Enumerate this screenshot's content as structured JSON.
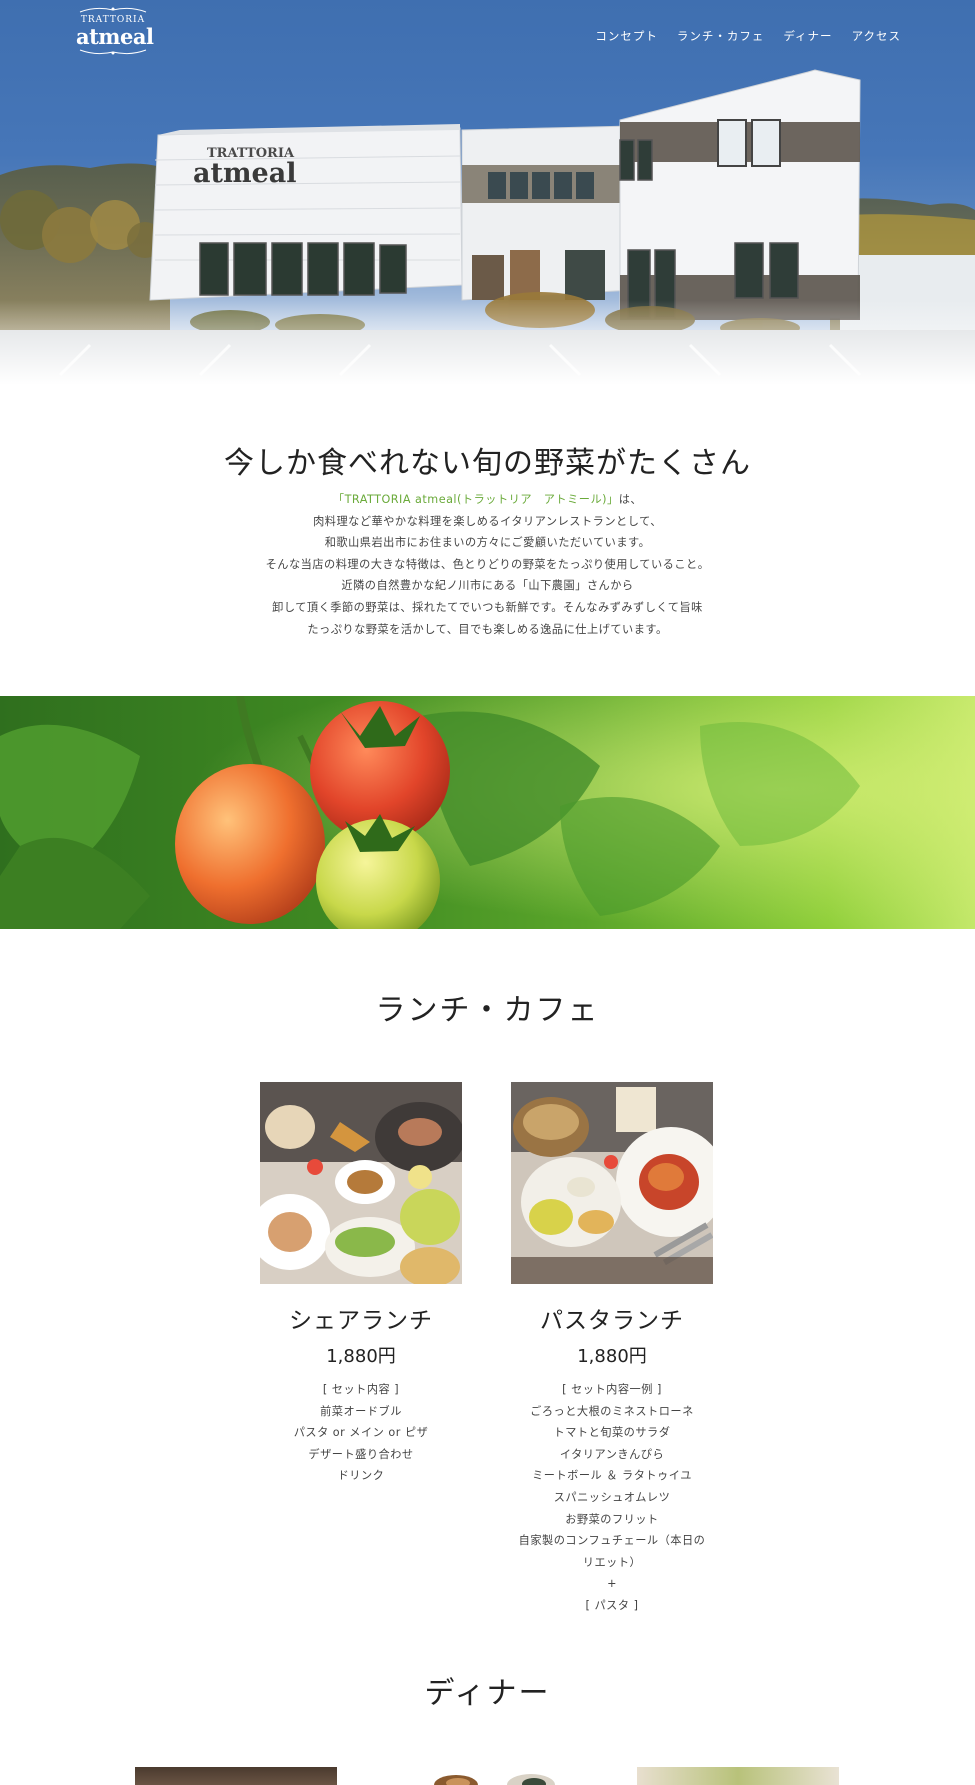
{
  "header": {
    "logo_small": "TRATTORIA",
    "logo_big": "atmeal",
    "nav": [
      "コンセプト",
      "ランチ・カフェ",
      "ディナー",
      "アクセス"
    ]
  },
  "hero": {
    "sign_small": "TRATTORIA",
    "sign_big": "atmeal"
  },
  "concept": {
    "title": "今しか食べれない旬の野菜がたくさん",
    "lead_highlight": "「TRATTORIA atmeal(トラットリア　アトミール)」",
    "lead_rest": "は、",
    "lines": [
      "肉料理など華やかな料理を楽しめるイタリアンレストランとして、",
      "和歌山県岩出市にお住まいの方々にご愛顧いただいています。",
      "そんな当店の料理の大きな特徴は、色とりどりの野菜をたっぷり使用していること。",
      "近隣の自然豊かな紀ノ川市にある「山下農園」さんから",
      "卸して頂く季節の野菜は、採れたてでいつも新鮮です。そんなみずみずしくて旨味",
      "たっぷりな野菜を活かして、目でも楽しめる逸品に仕上げています。"
    ]
  },
  "lunch": {
    "title": "ランチ・カフェ",
    "menus": [
      {
        "name": "シェアランチ",
        "price": "1,880円",
        "lines": [
          "[ セット内容 ]",
          "前菜オードブル",
          "パスタ or メイン or ピザ",
          "デザート盛り合わせ",
          "ドリンク"
        ]
      },
      {
        "name": "パスタランチ",
        "price": "1,880円",
        "lines": [
          "[ セット内容一例 ]",
          "ごろっと大根のミネストローネ",
          "トマトと旬菜のサラダ",
          "イタリアンきんぴら",
          "ミートボール ＆ ラタトゥイユ",
          "スパニッシュオムレツ",
          "お野菜のフリット",
          "自家製のコンフュチェール（本日の",
          "リエット）",
          "+",
          "[ パスタ ]"
        ]
      }
    ]
  },
  "dinner": {
    "title": "ディナー"
  },
  "colors": {
    "sky": "#4676b8",
    "accent_green": "#6aaa3a",
    "heading": "#222222",
    "body_text": "#444444"
  }
}
